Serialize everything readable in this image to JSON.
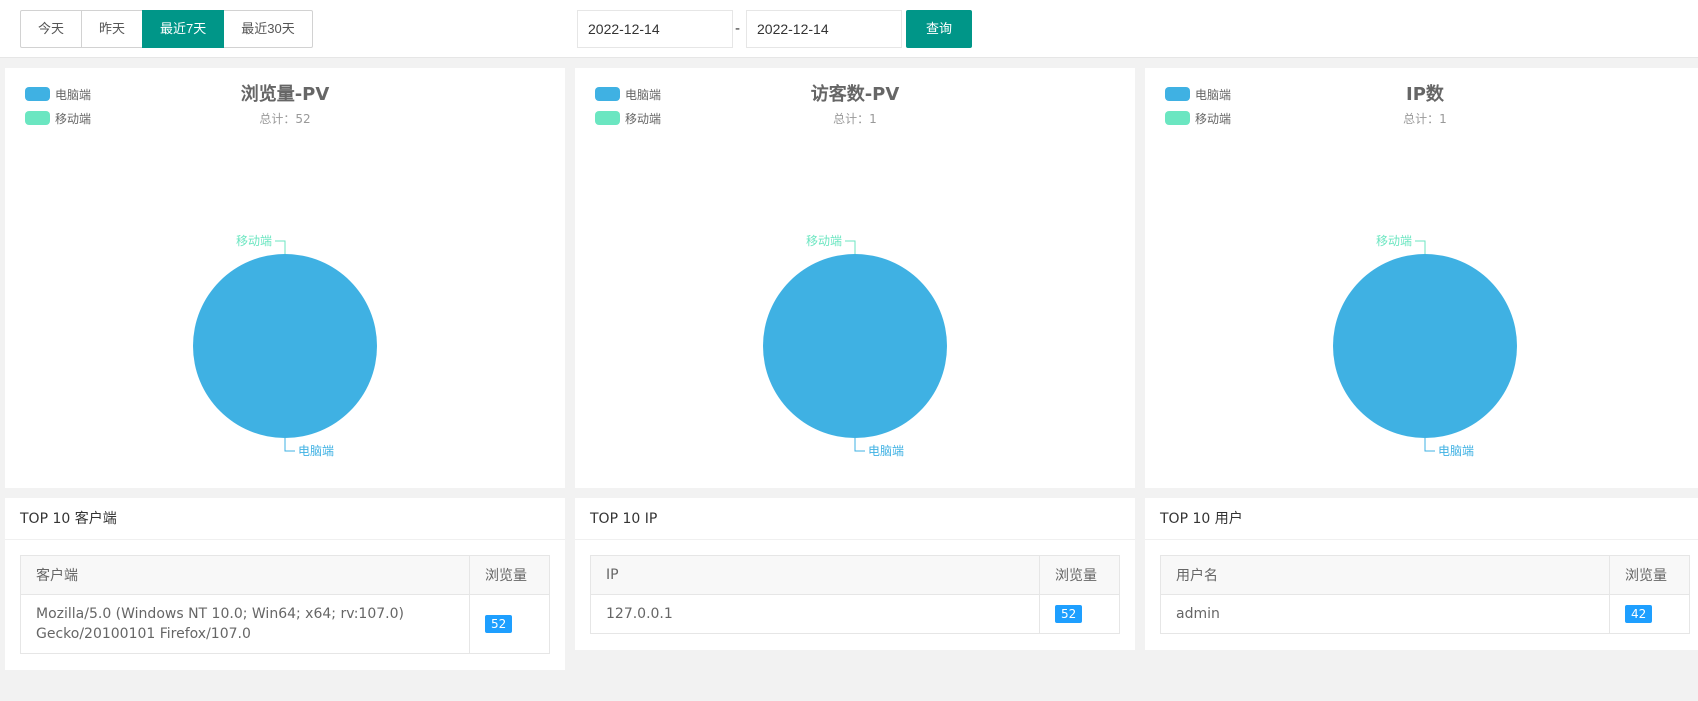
{
  "toolbar": {
    "ranges": [
      "今天",
      "昨天",
      "最近7天",
      "最近30天"
    ],
    "active_range": "最近7天",
    "date_start": "2022-12-14",
    "date_separator": "-",
    "date_end": "2022-12-14",
    "query_label": "查询"
  },
  "colors": {
    "accent": "#009688",
    "desktop": "#3fb1e3",
    "mobile": "#6be6c1",
    "badge": "#1e9fff"
  },
  "legend": {
    "desktop": "电脑端",
    "mobile": "移动端"
  },
  "chart_data": [
    {
      "type": "pie",
      "title": "浏览量-PV",
      "subtitle": "总计：52",
      "categories": [
        "电脑端",
        "移动端"
      ],
      "values": [
        52,
        0
      ],
      "legend_position": "top-left"
    },
    {
      "type": "pie",
      "title": "访客数-PV",
      "subtitle": "总计：1",
      "categories": [
        "电脑端",
        "移动端"
      ],
      "values": [
        1,
        0
      ],
      "legend_position": "top-left"
    },
    {
      "type": "pie",
      "title": "IP数",
      "subtitle": "总计：1",
      "categories": [
        "电脑端",
        "移动端"
      ],
      "values": [
        1,
        0
      ],
      "legend_position": "top-left"
    }
  ],
  "tables": {
    "clients": {
      "title": "TOP 10 客户端",
      "headers": [
        "客户端",
        "浏览量"
      ],
      "rows": [
        {
          "name": "Mozilla/5.0 (Windows NT 10.0; Win64; x64; rv:107.0) Gecko/20100101 Firefox/107.0",
          "count": "52"
        }
      ]
    },
    "ips": {
      "title": "TOP 10 IP",
      "headers": [
        "IP",
        "浏览量"
      ],
      "rows": [
        {
          "name": "127.0.0.1",
          "count": "52"
        }
      ]
    },
    "users": {
      "title": "TOP 10 用户",
      "headers": [
        "用户名",
        "浏览量"
      ],
      "rows": [
        {
          "name": "admin",
          "count": "42"
        }
      ]
    }
  }
}
